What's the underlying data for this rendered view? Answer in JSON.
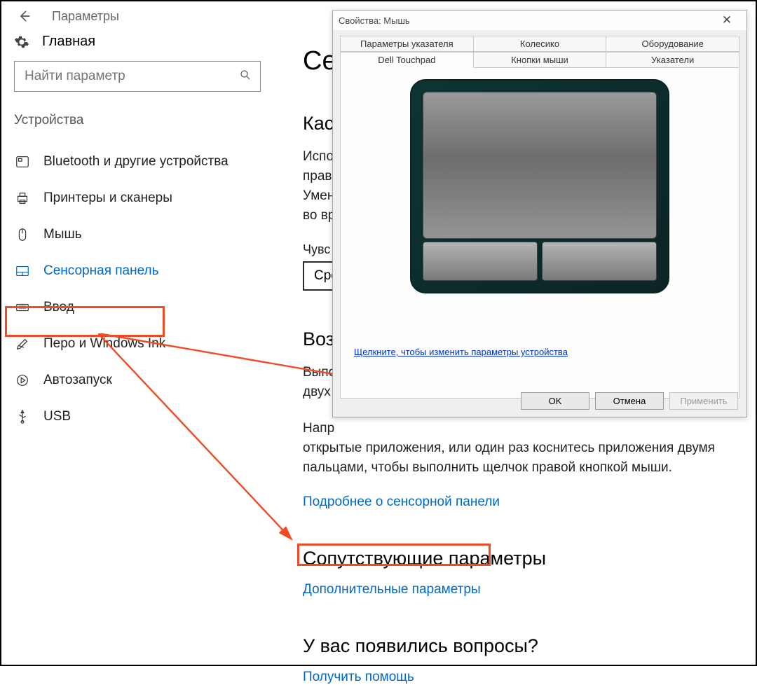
{
  "header": {
    "title": "Параметры"
  },
  "home": {
    "label": "Главная"
  },
  "search": {
    "placeholder": "Найти параметр"
  },
  "sidebar": {
    "group": "Устройства",
    "items": [
      {
        "icon": "bluetooth",
        "label": "Bluetooth и другие устройства"
      },
      {
        "icon": "printer",
        "label": "Принтеры и сканеры"
      },
      {
        "icon": "mouse",
        "label": "Мышь"
      },
      {
        "icon": "touchpad",
        "label": "Сенсорная панель",
        "active": true
      },
      {
        "icon": "keyboard",
        "label": "Ввод"
      },
      {
        "icon": "pen",
        "label": "Перо и Windows Ink"
      },
      {
        "icon": "autoplay",
        "label": "Автозапуск"
      },
      {
        "icon": "usb",
        "label": "USB"
      }
    ]
  },
  "main": {
    "h1": "Се",
    "h2a": "Каса",
    "para1_l1": "Испо",
    "para1_l2": "прав",
    "para1_l3": "Умен",
    "para1_l4": "во вр",
    "sens_lbl": "Чувс",
    "drop_val": "Сре",
    "h2b": "Возн",
    "para2_l1": "Выпо",
    "para2_l2": "двух",
    "para3": "Напр",
    "para3_rest": "открытые приложения, или один раз коснитесь приложения двумя пальцами, чтобы выполнить щелчок правой кнопкой мыши.",
    "link_learn": "Подробнее о сенсорной панели",
    "h2c": "Сопутствующие параметры",
    "link_add": "Дополнительные параметры",
    "h2d": "У вас появились вопросы?",
    "link_help": "Получить помощь"
  },
  "dialog": {
    "title": "Свойства: Мышь",
    "tabs_row1": [
      "Параметры указателя",
      "Колесико",
      "Оборудование"
    ],
    "tabs_row2": [
      "Dell Touchpad",
      "Кнопки мыши",
      "Указатели"
    ],
    "device_link": "Щелкните, чтобы изменить параметры устройства ",
    "ok": "OK",
    "cancel": "Отмена",
    "apply": "Применить"
  }
}
